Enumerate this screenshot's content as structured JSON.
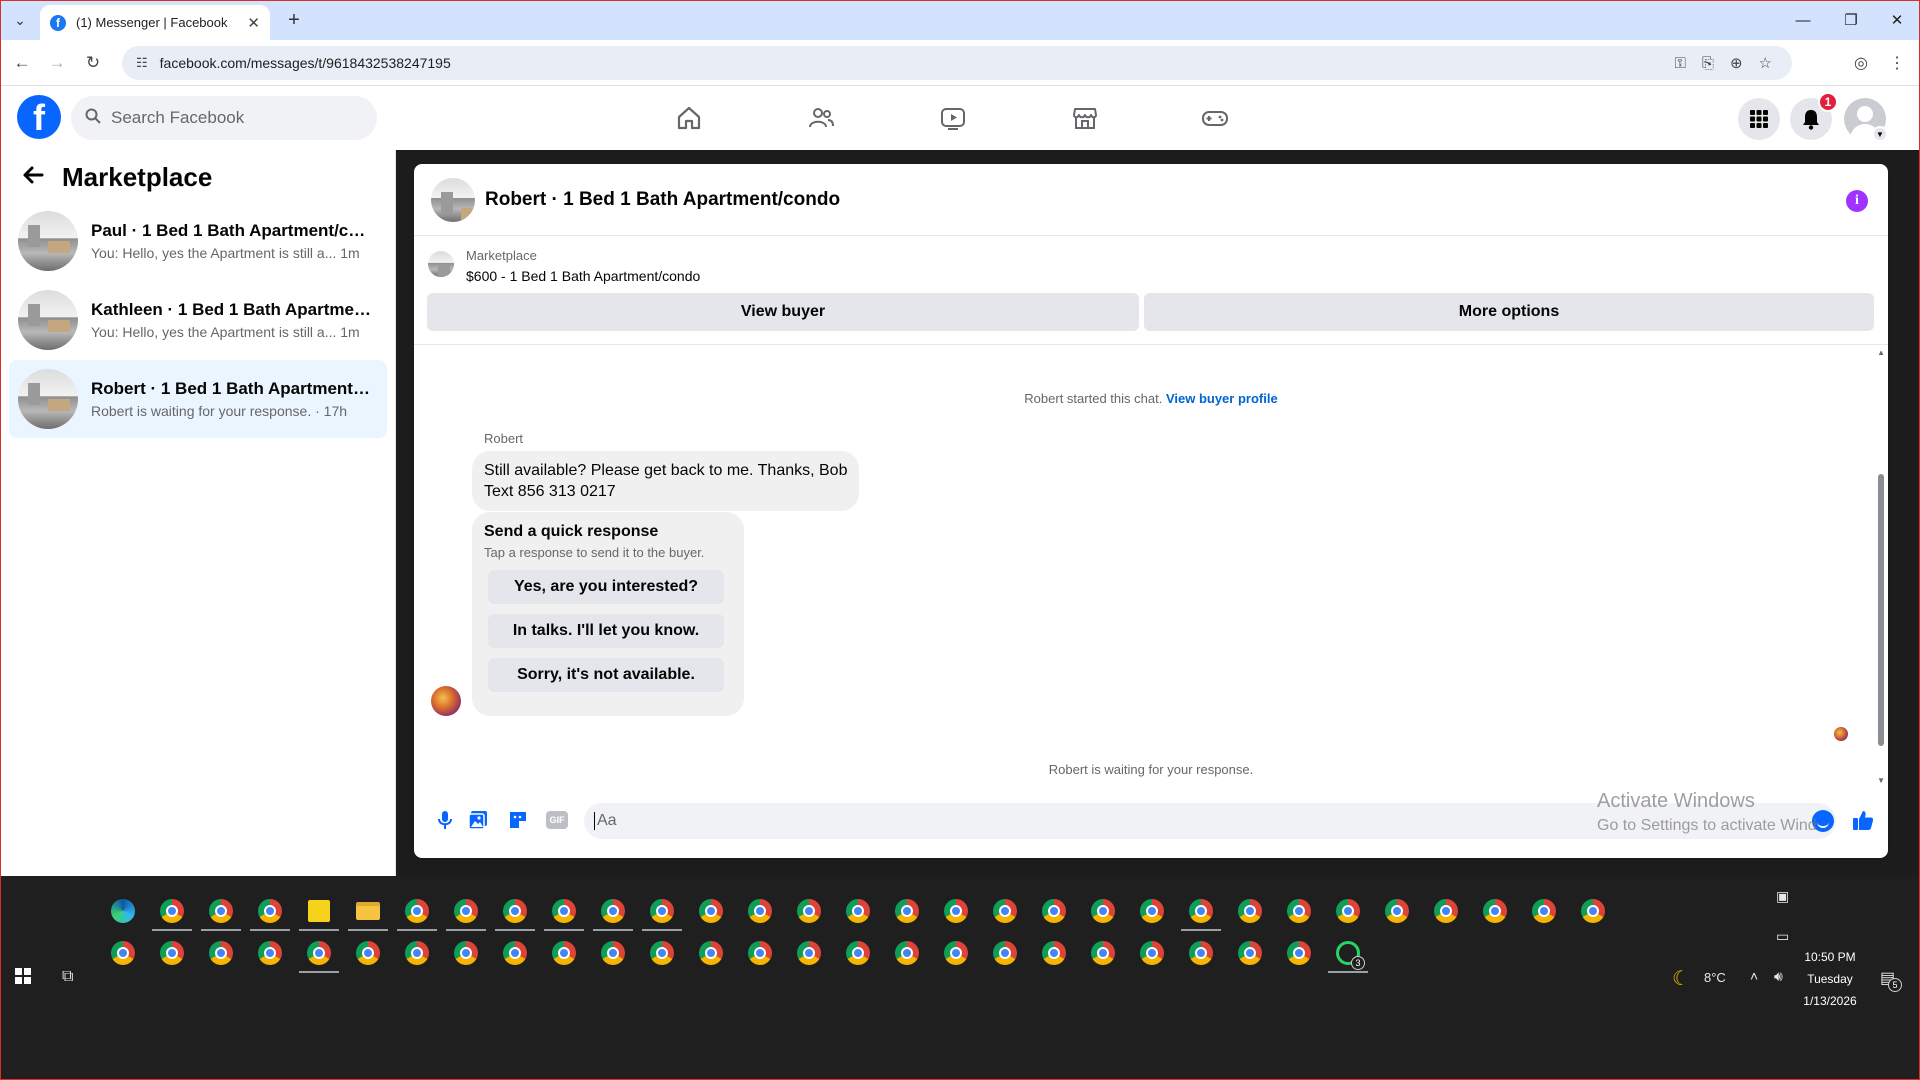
{
  "browser": {
    "tab_title": "(1) Messenger | Facebook",
    "url": "facebook.com/messages/t/9618432538247195"
  },
  "facebook": {
    "search_placeholder": "Search Facebook",
    "notification_count": "1",
    "brand_color": "#0866ff"
  },
  "sidebar": {
    "title": "Marketplace",
    "conversations": [
      {
        "name": "Paul · 1 Bed 1 Bath Apartment/con...",
        "preview": "You: Hello, yes the Apartment is still a... 1m",
        "active": false
      },
      {
        "name": "Kathleen · 1 Bed 1 Bath Apartment...",
        "preview": "You: Hello, yes the Apartment is still a... 1m",
        "active": false
      },
      {
        "name": "Robert · 1 Bed 1 Bath Apartment/c...",
        "preview": "Robert is waiting for your response. · 17h",
        "active": true
      }
    ]
  },
  "chat": {
    "title": "Robert · 1 Bed 1 Bath Apartment/condo",
    "marketplace_label": "Marketplace",
    "listing": "$600 - 1 Bed 1 Bath Apartment/condo",
    "view_buyer": "View buyer",
    "more_options": "More options",
    "started_text": "Robert started this chat.",
    "view_buyer_profile": "View buyer profile",
    "sender": "Robert",
    "message_line1": "Still available? Please get back to me. Thanks, Bob",
    "message_line2": "Text 856 313 0217",
    "quick_title": "Send a quick response",
    "quick_sub": "Tap a response to send it to the buyer.",
    "quick_responses": [
      "Yes, are you interested?",
      "In talks. I'll let you know.",
      "Sorry, it's not available."
    ],
    "waiting_text": "Robert is waiting for your response.",
    "input_placeholder": "Aa"
  },
  "watermark": {
    "line1": "Activate Windows",
    "line2": "Go to Settings to activate Wind"
  },
  "taskbar": {
    "weather": "8°C",
    "time": "10:50 PM",
    "day": "Tuesday",
    "date": "1/13/2026",
    "whatsapp_badge": "3",
    "notif_badge": "5"
  }
}
